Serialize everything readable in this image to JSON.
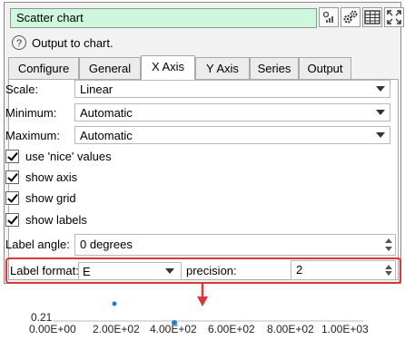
{
  "header": {
    "title_value": "Scatter chart",
    "help_text": "Output to chart.",
    "toolbar_icons": [
      "chart-settings-icon",
      "gears-icon",
      "table-icon",
      "expand-icon"
    ]
  },
  "tabs": [
    {
      "label": "Configure",
      "active": false
    },
    {
      "label": "General",
      "active": false
    },
    {
      "label": "X Axis",
      "active": true
    },
    {
      "label": "Y Axis",
      "active": false
    },
    {
      "label": "Series",
      "active": false
    },
    {
      "label": "Output",
      "active": false
    }
  ],
  "form": {
    "scale": {
      "label": "Scale:",
      "value": "Linear"
    },
    "minimum": {
      "label": "Minimum:",
      "value": "Automatic"
    },
    "maximum": {
      "label": "Maximum:",
      "value": "Automatic"
    },
    "checks": [
      {
        "label": "use 'nice' values",
        "checked": true
      },
      {
        "label": "show axis",
        "checked": true
      },
      {
        "label": "show grid",
        "checked": true
      },
      {
        "label": "show labels",
        "checked": true
      }
    ],
    "label_angle": {
      "label": "Label angle:",
      "value": "0 degrees"
    },
    "label_format": {
      "label": "Label format:",
      "value": "E"
    },
    "precision": {
      "label": "precision:",
      "value": "2"
    }
  },
  "chart_preview": {
    "y_tick": "0.21",
    "x_ticks": [
      "0.00E+00",
      "2.00E+02",
      "4.00E+02",
      "6.00E+02",
      "8.00E+02",
      "1.00E+03"
    ]
  },
  "colors": {
    "highlight": "#d9363e",
    "title_bg": "#cff7dd",
    "point": "#2979c9"
  }
}
